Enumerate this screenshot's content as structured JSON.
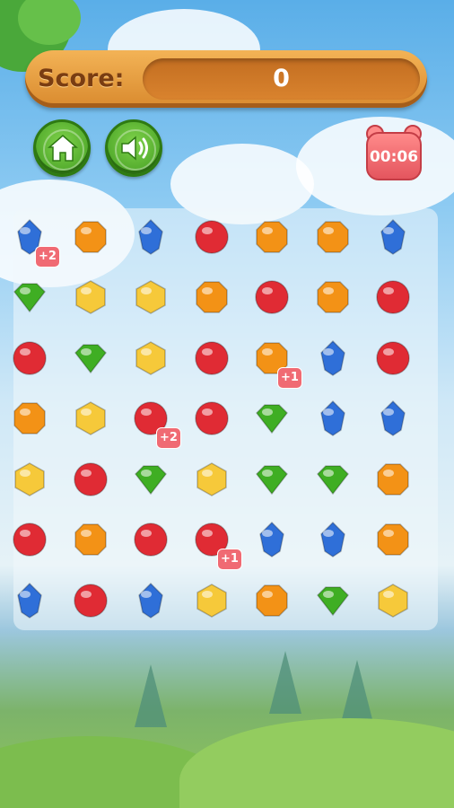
{
  "header": {
    "score_label": "Score:",
    "score_value": "0",
    "timer": "00:06"
  },
  "buttons": {
    "home_icon": "home-icon",
    "sound_icon": "speaker-icon"
  },
  "board": {
    "rows": [
      [
        "blue",
        "orange",
        "blue",
        "red",
        "orange",
        "orange",
        "blue"
      ],
      [
        "green",
        "yellow",
        "yellow",
        "orange",
        "red",
        "orange",
        "red"
      ],
      [
        "red",
        "green",
        "yellow",
        "red",
        "orange",
        "blue",
        "red"
      ],
      [
        "orange",
        "yellow",
        "red",
        "red",
        "green",
        "blue",
        "blue"
      ],
      [
        "yellow",
        "red",
        "green",
        "yellow",
        "green",
        "green",
        "orange"
      ],
      [
        "red",
        "orange",
        "red",
        "red",
        "blue",
        "blue",
        "orange"
      ],
      [
        "blue",
        "red",
        "blue",
        "yellow",
        "orange",
        "green",
        "yellow"
      ]
    ],
    "badges": [
      {
        "row": 0,
        "col": 0,
        "text": "+2"
      },
      {
        "row": 2,
        "col": 4,
        "text": "+1"
      },
      {
        "row": 3,
        "col": 2,
        "text": "+2"
      },
      {
        "row": 5,
        "col": 3,
        "text": "+1"
      }
    ]
  },
  "colors": {
    "red": "#e02b34",
    "orange": "#f39216",
    "blue": "#2f6fd8",
    "green": "#3fae23",
    "yellow": "#f6c93a",
    "badge": "#f06a73",
    "wood": "#d98a2e"
  }
}
